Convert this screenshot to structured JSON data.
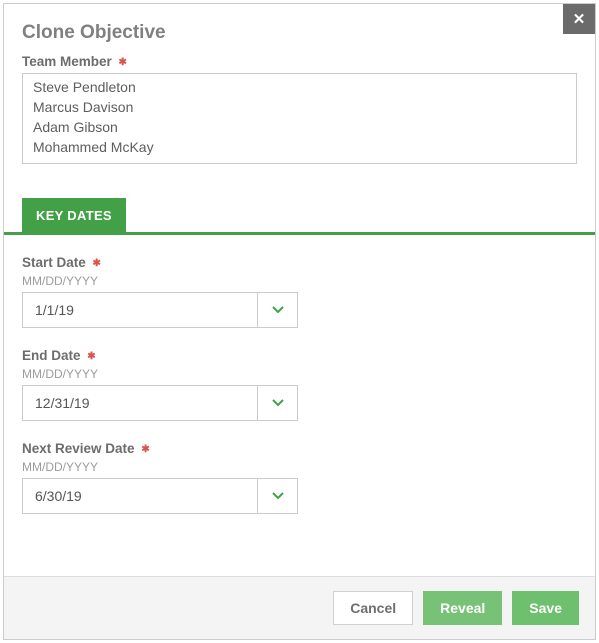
{
  "modal": {
    "title": "Clone Objective"
  },
  "team_member": {
    "label": "Team Member",
    "items": [
      "Steve Pendleton",
      "Marcus Davison",
      "Adam Gibson",
      "Mohammed McKay"
    ]
  },
  "tabs": {
    "key_dates": "KEY DATES"
  },
  "dates": {
    "hint": "MM/DD/YYYY",
    "start": {
      "label": "Start Date",
      "value": "1/1/19"
    },
    "end": {
      "label": "End Date",
      "value": "12/31/19"
    },
    "next_review": {
      "label": "Next Review Date",
      "value": "6/30/19"
    }
  },
  "footer": {
    "cancel": "Cancel",
    "reveal": "Reveal",
    "save": "Save"
  },
  "colors": {
    "accent_green": "#43a047",
    "required_star": "#d9534f"
  }
}
